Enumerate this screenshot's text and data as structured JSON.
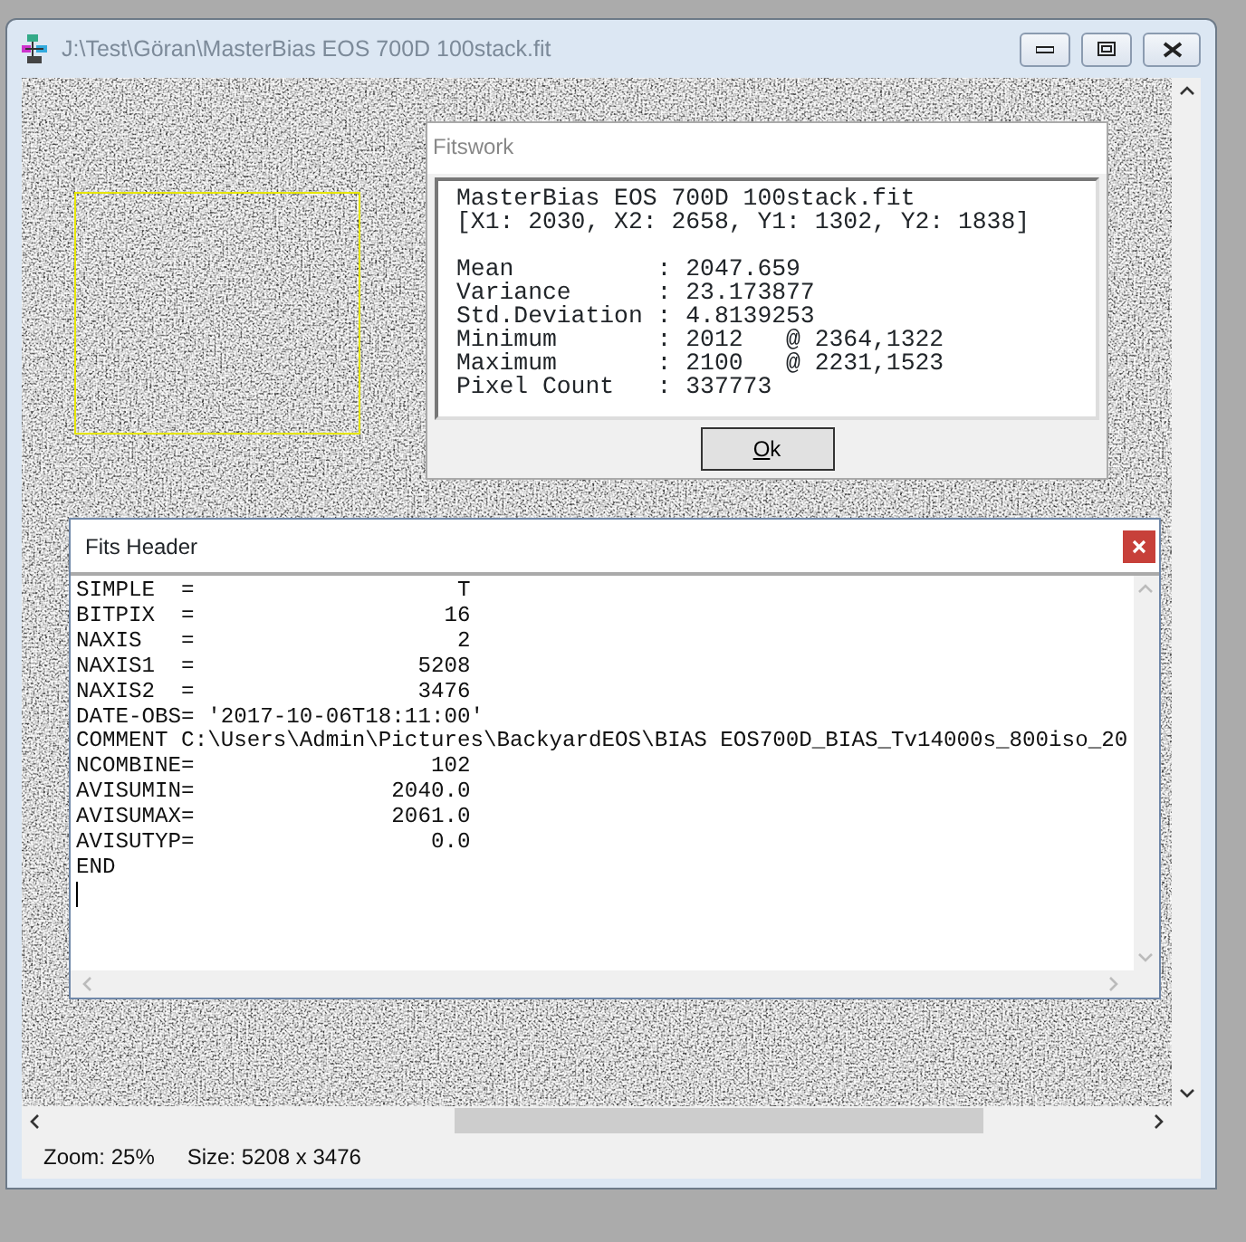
{
  "window": {
    "title": "J:\\Test\\Göran\\MasterBias EOS 700D 100stack.fit"
  },
  "statistics_dialog": {
    "title": "Fitswork",
    "file": "MasterBias EOS 700D 100stack.fit",
    "region": "[X1: 2030, X2: 2658, Y1: 1302, Y2: 1838]",
    "rows": [
      "Mean          : 2047.659",
      "Variance      : 23.173877",
      "Std.Deviation : 4.8139253",
      "Minimum       : 2012   @ 2364,1322",
      "Maximum       : 2100   @ 2231,1523",
      "Pixel Count   : 337773"
    ],
    "button": "Ok"
  },
  "header_window": {
    "title": "Fits Header",
    "lines": [
      "SIMPLE  =                    T",
      "BITPIX  =                   16",
      "NAXIS   =                    2",
      "NAXIS1  =                 5208",
      "NAXIS2  =                 3476",
      "DATE-OBS= '2017-10-06T18:11:00'",
      "COMMENT C:\\Users\\Admin\\Pictures\\BackyardEOS\\BIAS EOS700D_BIAS_Tv14000s_800iso_20",
      "NCOMBINE=                  102",
      "AVISUMIN=               2040.0",
      "AVISUMAX=               2061.0",
      "AVISUTYP=                  0.0",
      "END"
    ]
  },
  "status_bar": {
    "zoom": "Zoom: 25%",
    "size": "Size: 5208 x 3476"
  }
}
